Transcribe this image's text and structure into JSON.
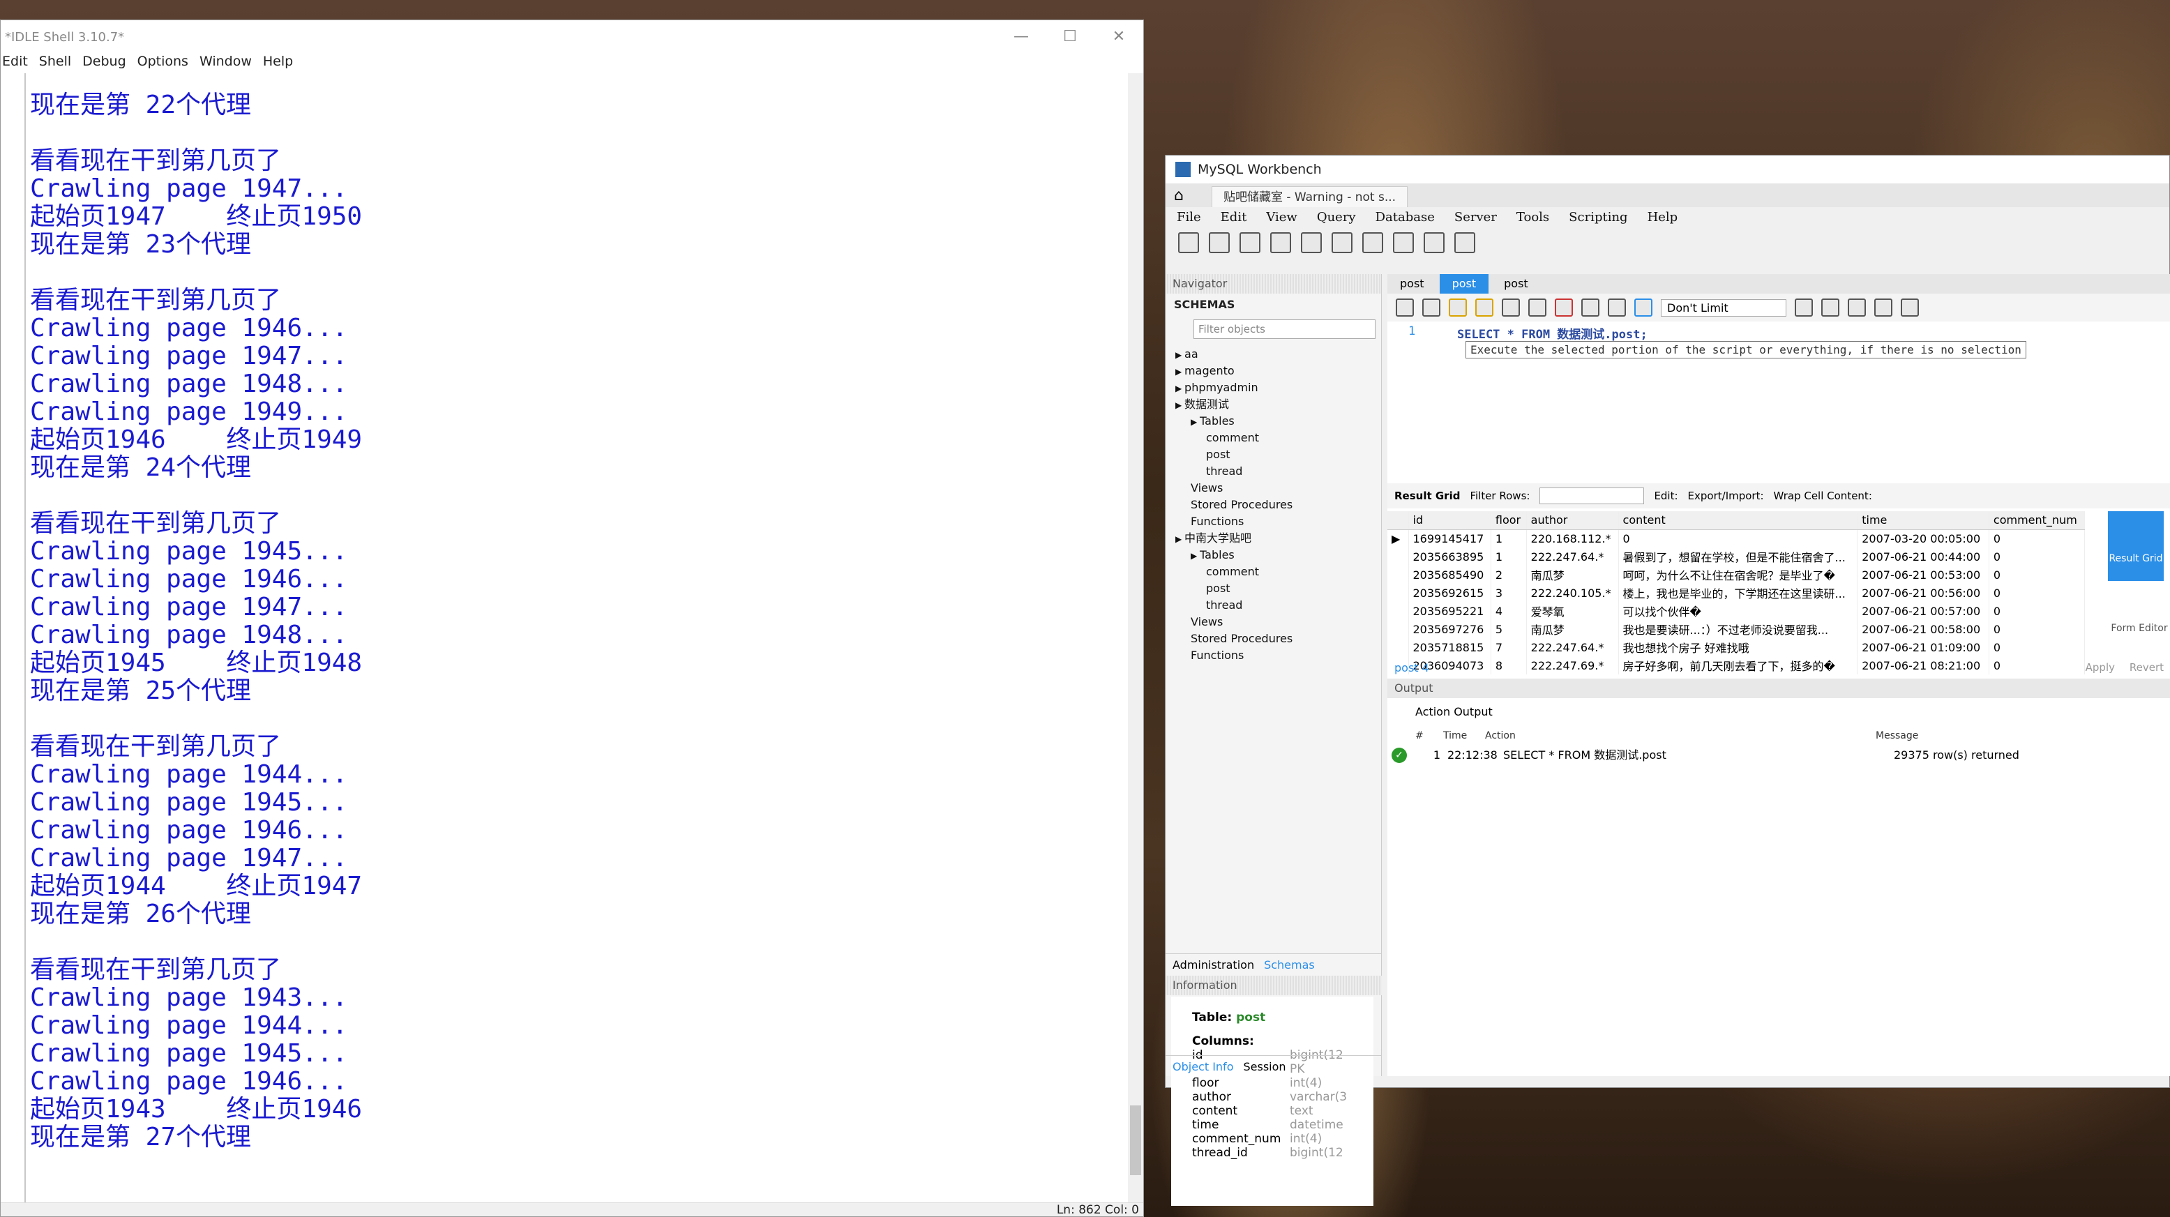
{
  "idle": {
    "title": "*IDLE Shell 3.10.7*",
    "menu": [
      "Edit",
      "Shell",
      "Debug",
      "Options",
      "Window",
      "Help"
    ],
    "lines": [
      "现在是第 22个代理",
      "",
      "看看现在干到第几页了",
      "Crawling page 1947...",
      "起始页1947    终止页1950",
      "现在是第 23个代理",
      "",
      "看看现在干到第几页了",
      "Crawling page 1946...",
      "Crawling page 1947...",
      "Crawling page 1948...",
      "Crawling page 1949...",
      "起始页1946    终止页1949",
      "现在是第 24个代理",
      "",
      "看看现在干到第几页了",
      "Crawling page 1945...",
      "Crawling page 1946...",
      "Crawling page 1947...",
      "Crawling page 1948...",
      "起始页1945    终止页1948",
      "现在是第 25个代理",
      "",
      "看看现在干到第几页了",
      "Crawling page 1944...",
      "Crawling page 1945...",
      "Crawling page 1946...",
      "Crawling page 1947...",
      "起始页1944    终止页1947",
      "现在是第 26个代理",
      "",
      "看看现在干到第几页了",
      "Crawling page 1943...",
      "Crawling page 1944...",
      "Crawling page 1945...",
      "Crawling page 1946...",
      "起始页1943    终止页1946",
      "现在是第 27个代理"
    ],
    "status": "Ln: 862  Col: 0"
  },
  "wb": {
    "title": "MySQL Workbench",
    "conn_tab": "贴吧储藏室 - Warning - not s...",
    "menu": [
      "File",
      "Edit",
      "View",
      "Query",
      "Database",
      "Server",
      "Tools",
      "Scripting",
      "Help"
    ],
    "nav": "Navigator",
    "schemas": "SCHEMAS",
    "filter": "Filter objects",
    "tree": [
      "aa",
      "magento",
      "phpmyadmin",
      "数据测试",
      "Tables",
      "comment",
      "post",
      "thread",
      "Views",
      "Stored Procedures",
      "Functions",
      "中南大学贴吧",
      "Tables",
      "comment",
      "post",
      "thread",
      "Views",
      "Stored Procedures",
      "Functions"
    ],
    "sidetabs": [
      "Administration",
      "Schemas"
    ],
    "info": "Information",
    "table_label": "Table:",
    "table_name": "post",
    "columns_label": "Columns:",
    "columns": [
      [
        "id",
        "bigint(12"
      ],
      [
        "",
        "PK"
      ],
      [
        "floor",
        "int(4)"
      ],
      [
        "author",
        "varchar(3"
      ],
      [
        "content",
        "text"
      ],
      [
        "time",
        "datetime"
      ],
      [
        "comment_num",
        "int(4)"
      ],
      [
        "thread_id",
        "bigint(12"
      ]
    ],
    "bottomtabs": [
      "Object Info",
      "Session"
    ],
    "sqltabs": [
      "post",
      "post",
      "post"
    ],
    "limit": "Don't Limit",
    "line_no": "1",
    "sql": "SELECT * FROM 数据测试.post;",
    "tooltip": "Execute the selected portion of the script or everything, if there is no selection",
    "rg": {
      "result": "Result Grid",
      "filter": "Filter Rows:",
      "edit": "Edit:",
      "export": "Export/Import:",
      "wrap": "Wrap Cell Content:"
    },
    "headers": [
      "id",
      "floor",
      "author",
      "content",
      "time",
      "comment_num"
    ],
    "rows": [
      [
        "1699145417",
        "1",
        "220.168.112.*",
        "0",
        "2007-03-20 00:05:00",
        "0"
      ],
      [
        "2035663895",
        "1",
        "222.247.64.*",
        "暑假到了，想留在学校，但是不能住宿舍了...",
        "2007-06-21 00:44:00",
        "0"
      ],
      [
        "2035685490",
        "2",
        "南瓜梦",
        "呵呵，为什么不让住在宿舍呢？是毕业了�",
        "2007-06-21 00:53:00",
        "0"
      ],
      [
        "2035692615",
        "3",
        "222.240.105.*",
        "楼上，我也是毕业的，下学期还在这里读研...",
        "2007-06-21 00:56:00",
        "0"
      ],
      [
        "2035695221",
        "4",
        "爱琴氧",
        "可以找个伙伴�",
        "2007-06-21 00:57:00",
        "0"
      ],
      [
        "2035697276",
        "5",
        "南瓜梦",
        "我也是要读研...：）不过老师没说要留我...",
        "2007-06-21 00:58:00",
        "0"
      ],
      [
        "2035718815",
        "7",
        "222.247.64.*",
        "我也想找个房子 好难找哦",
        "2007-06-21 01:09:00",
        "0"
      ],
      [
        "2036094073",
        "8",
        "222.247.69.*",
        "房子好多啊，前几天刚去看了下，挺多的�",
        "2007-06-21 08:21:00",
        "0"
      ]
    ],
    "side_btn1": "Result Grid",
    "side_btn2": "Form Editor",
    "result_tab": "post 4",
    "apply": "Apply",
    "revert": "Revert",
    "output": "Output",
    "action_output": "Action Output",
    "out_headers": [
      "#",
      "Time",
      "Action",
      "Message"
    ],
    "out_row": [
      "1",
      "22:12:38",
      "SELECT * FROM 数据测试.post",
      "29375 row(s) returned"
    ]
  }
}
